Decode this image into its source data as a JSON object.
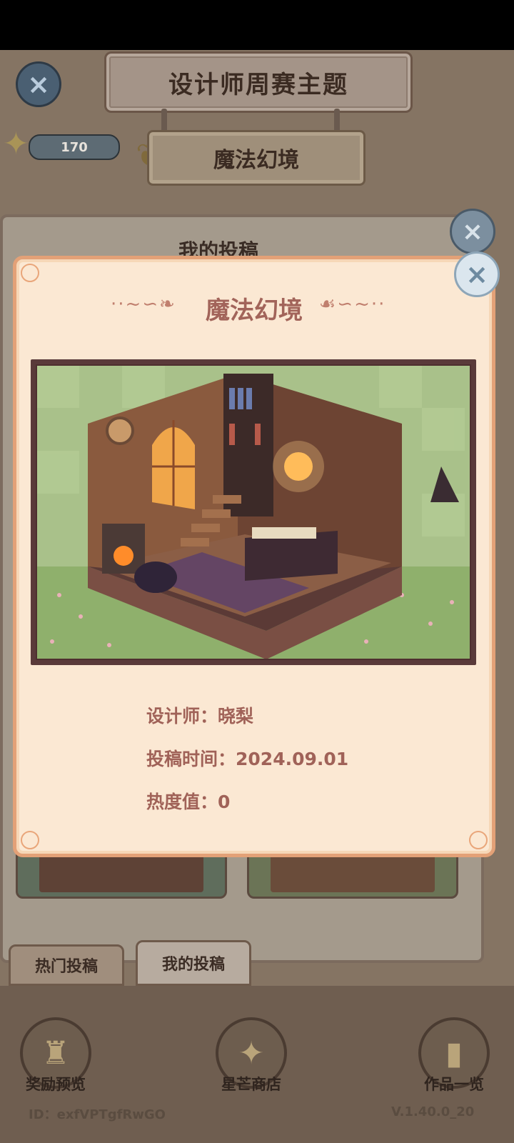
{
  "header": {
    "title": "设计师周赛主题",
    "theme": "魔法幻境",
    "star_count": "170"
  },
  "background_panel": {
    "title": "我的投稿",
    "tabs": [
      {
        "label": "热门投稿"
      },
      {
        "label": "我的投稿"
      }
    ]
  },
  "modal": {
    "title": "魔法幻境",
    "designer_label": "设计师：",
    "designer": "晓梨",
    "submit_time_label": "投稿时间：",
    "submit_time": "2024.09.01",
    "heat_label": "热度值：",
    "heat": "0"
  },
  "bottom_nav": [
    {
      "label": "奖励预览",
      "icon": "trophy-icon"
    },
    {
      "label": "星芒商店",
      "icon": "star-icon"
    },
    {
      "label": "作品一览",
      "icon": "book-icon"
    }
  ],
  "footer": {
    "id_text": "ID：exfVPTgfRwGO",
    "version": "V.1.40.0_20"
  },
  "colors": {
    "modal_bg": "#fbe8d3",
    "modal_border": "#e3a177",
    "title_color": "#a2645a",
    "text_color": "#a06258"
  }
}
